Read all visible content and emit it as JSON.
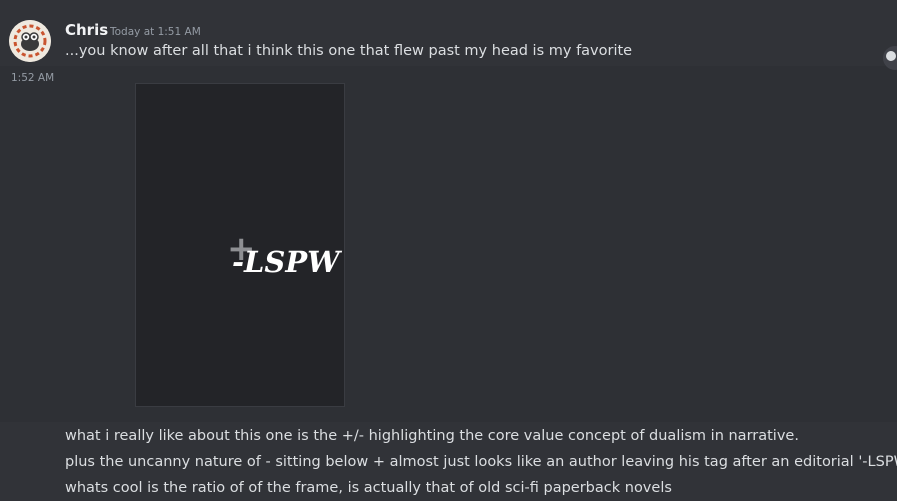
{
  "message": {
    "author": "Chris",
    "timestamp_full": "Today at 1:51 AM",
    "line1": "...you know after all that i think this one that flew past my head is my favorite",
    "timestamp_short": "1:52 AM",
    "image": {
      "plus_mark": "+",
      "tag": "-LSPW"
    },
    "followup_lines": [
      "what i really like about this one is the +/- highlighting the core value concept of dualism in narrative.",
      "plus the uncanny nature of - sitting below + almost just looks like an author leaving his tag after an editorial '-LSPW'",
      "whats cool is the ratio of of the frame, is actually that of old sci-fi paperback novels"
    ]
  }
}
